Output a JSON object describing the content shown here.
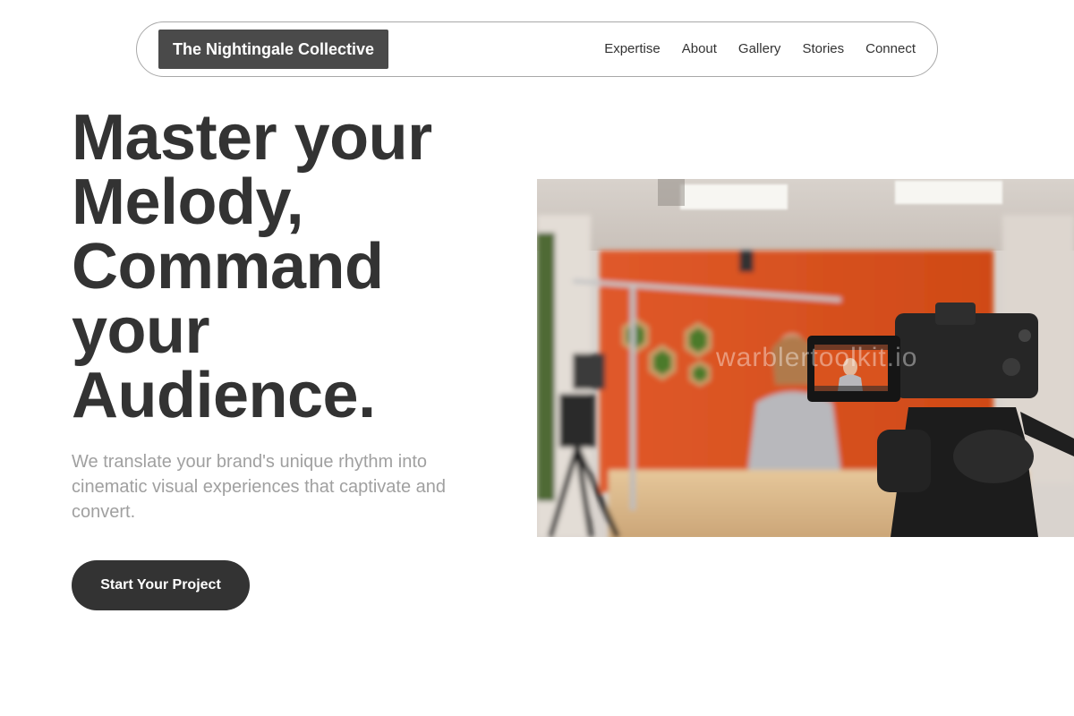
{
  "nav": {
    "brand": "The Nightingale Collective",
    "links": [
      {
        "label": "Expertise"
      },
      {
        "label": "About"
      },
      {
        "label": "Gallery"
      },
      {
        "label": "Stories"
      },
      {
        "label": "Connect"
      }
    ]
  },
  "hero": {
    "title_lines": [
      "Master your",
      "Melody,",
      "Command",
      "your",
      "Audience."
    ],
    "subtitle": "We translate your brand's unique rhythm into cinematic visual experiences that captivate and convert.",
    "cta_label": "Start Your Project",
    "image_watermark": "warblertoolkit.io"
  },
  "colors": {
    "text_dark": "#333333",
    "brand_bg": "#4a4a4a",
    "subtitle": "#a0a0a0",
    "studio_wall": "#d9531e"
  }
}
